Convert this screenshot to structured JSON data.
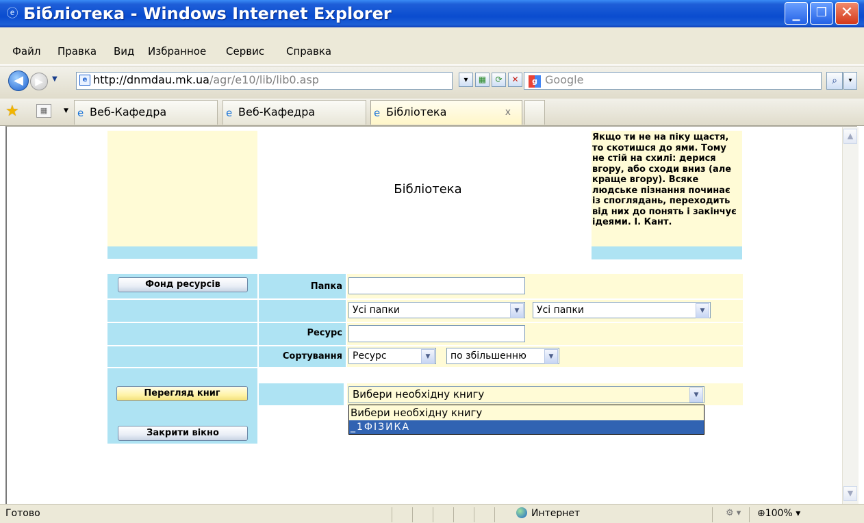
{
  "window": {
    "title": "Бібліотека - Windows Internet Explorer",
    "minimize": "_",
    "maximize": "❐",
    "close": "✕"
  },
  "menu": [
    "Файл",
    "Правка",
    "Вид",
    "Избранное",
    "Сервис",
    "Справка"
  ],
  "address": {
    "host": "http://dnmdau.mk.ua",
    "path": "/agr/e10/lib/lib0.asp"
  },
  "search": {
    "placeholder": "Google"
  },
  "tabs": [
    {
      "label": "Веб-Кафедра",
      "active": false
    },
    {
      "label": "Веб-Кафедра",
      "active": false
    },
    {
      "label": "Бібліотека",
      "active": true
    }
  ],
  "tab_close_glyph": "x",
  "page": {
    "heading": "Бібліотека",
    "quote": "Якщо ти не на піку щастя, то скотишся до ями. Тому не стій на схилі: дерися вгору, або сходи вниз (але краще вгору). Всяке людське пізнання починає із споглядань, переходить від них до понять і закінчує ідеями. І. Кант.",
    "fund_button": "Фонд ресурсів",
    "folder_label": "Папка",
    "folder_value": "",
    "folder_select_1": "Усі папки",
    "folder_select_2": "Усі папки",
    "resource_label": "Ресурс",
    "resource_value": "",
    "sort_label": "Сортування",
    "sort_field": "Ресурс",
    "sort_order": "по збільшенню",
    "browse_button": "Перегляд книг",
    "book_select": "Вибери необхідну книгу",
    "book_options": [
      "Вибери необхідну книгу",
      "_1ФІЗИКА"
    ],
    "close_button": "Закрити вікно"
  },
  "status": {
    "text": "Готово",
    "zone": "Интернет",
    "zoom": "100%"
  },
  "colors": {
    "title_bar": "#0a4ccf",
    "light_yellow": "#fffbd6",
    "light_cyan": "#aee3f3",
    "selection": "#3163b2"
  }
}
